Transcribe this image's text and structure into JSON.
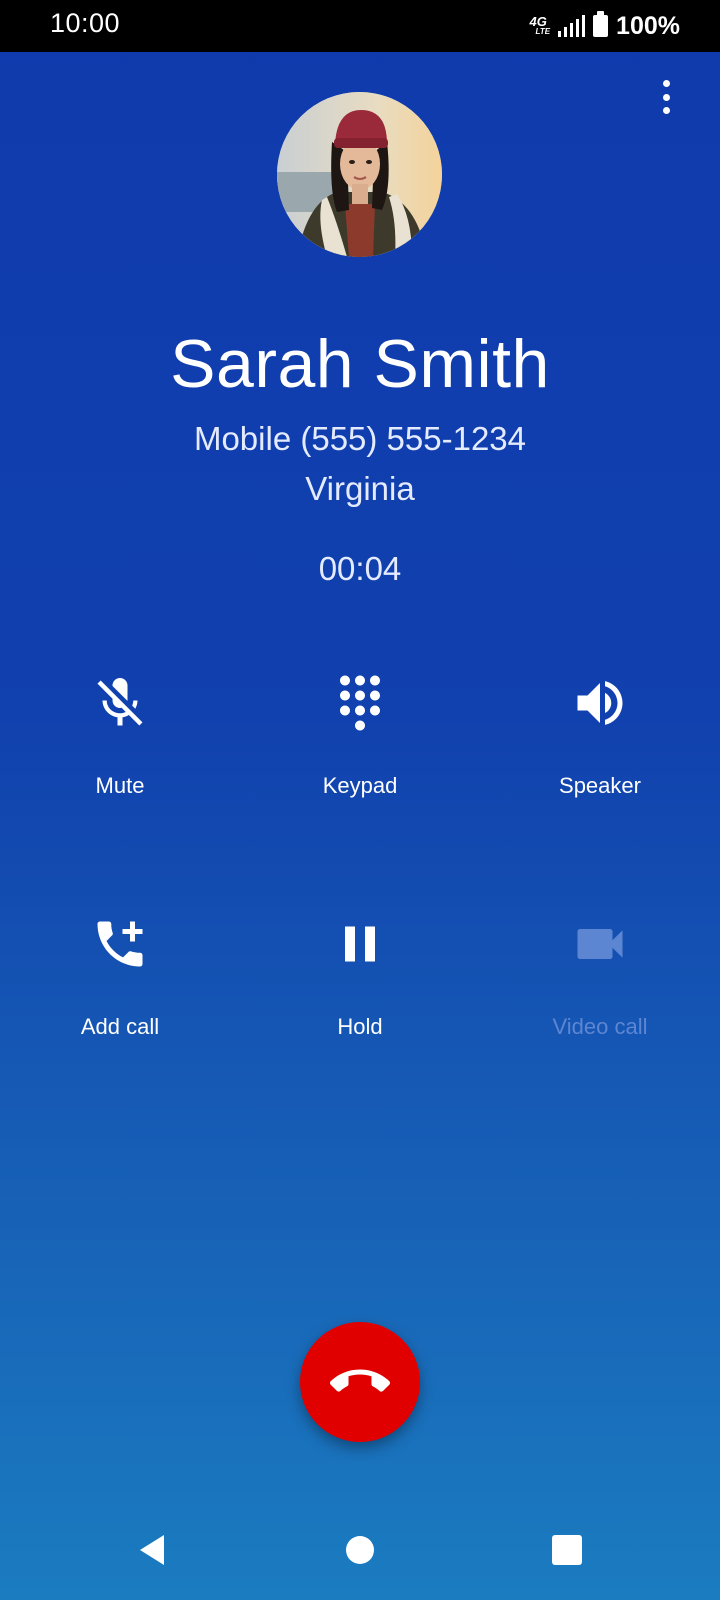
{
  "status_bar": {
    "time": "10:00",
    "network_top": "4G",
    "network_bottom": "LTE",
    "battery": "100%",
    "icons": [
      "signal-icon",
      "battery-icon"
    ]
  },
  "caller": {
    "name": "Sarah Smith",
    "number": "Mobile (555) 555-1234",
    "location": "Virginia",
    "timer": "00:04"
  },
  "actions": {
    "mute": {
      "label": "Mute",
      "icon": "mic-off-icon"
    },
    "keypad": {
      "label": "Keypad",
      "icon": "dialpad-icon"
    },
    "speaker": {
      "label": "Speaker",
      "icon": "speaker-icon"
    },
    "add_call": {
      "label": "Add call",
      "icon": "add-call-icon"
    },
    "hold": {
      "label": "Hold",
      "icon": "pause-icon"
    },
    "video_call": {
      "label": "Video call",
      "icon": "videocam-icon"
    }
  },
  "end_call": {
    "icon": "call-end-icon",
    "color": "#e00000"
  },
  "colors": {
    "background_top": "#0f3aad",
    "background_bottom": "#1b7cc0",
    "disabled_text": "#5c86d2"
  },
  "nav": {
    "icons": [
      "back-icon",
      "home-icon",
      "recents-icon"
    ]
  }
}
